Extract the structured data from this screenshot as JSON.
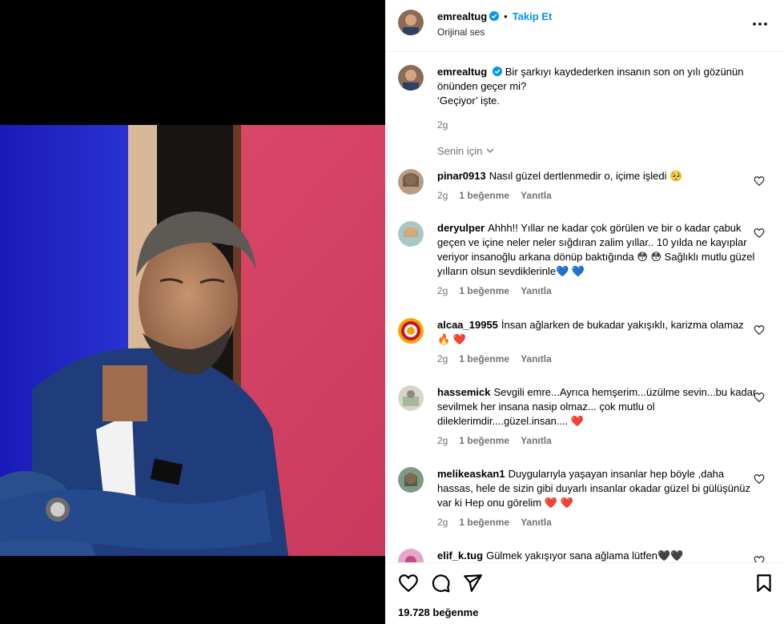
{
  "author": {
    "username": "emrealtug",
    "follow_label": "Takip Et",
    "audio_label": "Orijinal ses",
    "dot": "•"
  },
  "caption": {
    "username": "emrealtug",
    "line1": "Bir şarkıyı kaydederken insanın son on yılı gözünün önünden geçer mi?",
    "line2": "‘Geçiyor’ işte.",
    "time": "2g"
  },
  "for_you_label": "Senin için",
  "comments": [
    {
      "user": "pinar0913",
      "text": "Nasıl güzel dertlenmedir o, içime işledi 🥺",
      "time": "2g",
      "likes": "1 beğenme",
      "reply": "Yanıtla"
    },
    {
      "user": "deryulper",
      "text": "Ahhh!! Yıllar ne kadar çok görülen ve bir o kadar çabuk geçen ve içine neler neler sığdıran zalim yıllar.. 10 yılda ne kayıplar veriyor insanoğlu arkana dönüp baktığında 😳 😳 Sağlıklı mutlu güzel yılların olsun sevdiklerinle💙 💙",
      "time": "2g",
      "likes": "1 beğenme",
      "reply": "Yanıtla"
    },
    {
      "user": "alcaa_19955",
      "text": "İnsan ağlarken de bukadar yakışıklı, karizma olamaz 🔥 ❤️",
      "time": "2g",
      "likes": "1 beğenme",
      "reply": "Yanıtla"
    },
    {
      "user": "hassemick",
      "text": "Sevgili emre...Ayrıca hemşerim...üzülme sevin...bu kadar sevilmek her insana nasip olmaz... çok mutlu ol dileklerimdir....güzel.insan.... ❤️",
      "time": "2g",
      "likes": "1 beğenme",
      "reply": "Yanıtla"
    },
    {
      "user": "melikeaskan1",
      "text": "Duygularıyla yaşayan insanlar hep böyle ,daha hassas, hele de sizin gibi duyarlı insanlar okadar güzel bi gülüşünüz var ki Hep onu görelim ❤️ ❤️",
      "time": "2g",
      "likes": "1 beğenme",
      "reply": "Yanıtla"
    },
    {
      "user": "elif_k.tug",
      "text": "Gülmek yakışıyor sana ağlama lütfen🖤🖤",
      "time": "",
      "likes": "",
      "reply": ""
    }
  ],
  "likes_count": "19.728 beğenme",
  "icons": [
    "more-icon",
    "verified-icon",
    "heart-icon",
    "comment-icon",
    "share-icon",
    "save-icon",
    "chevron-down-icon"
  ],
  "colors": {
    "accent": "#0095f6",
    "muted": "#737373",
    "heart_red": "#ed4956"
  }
}
